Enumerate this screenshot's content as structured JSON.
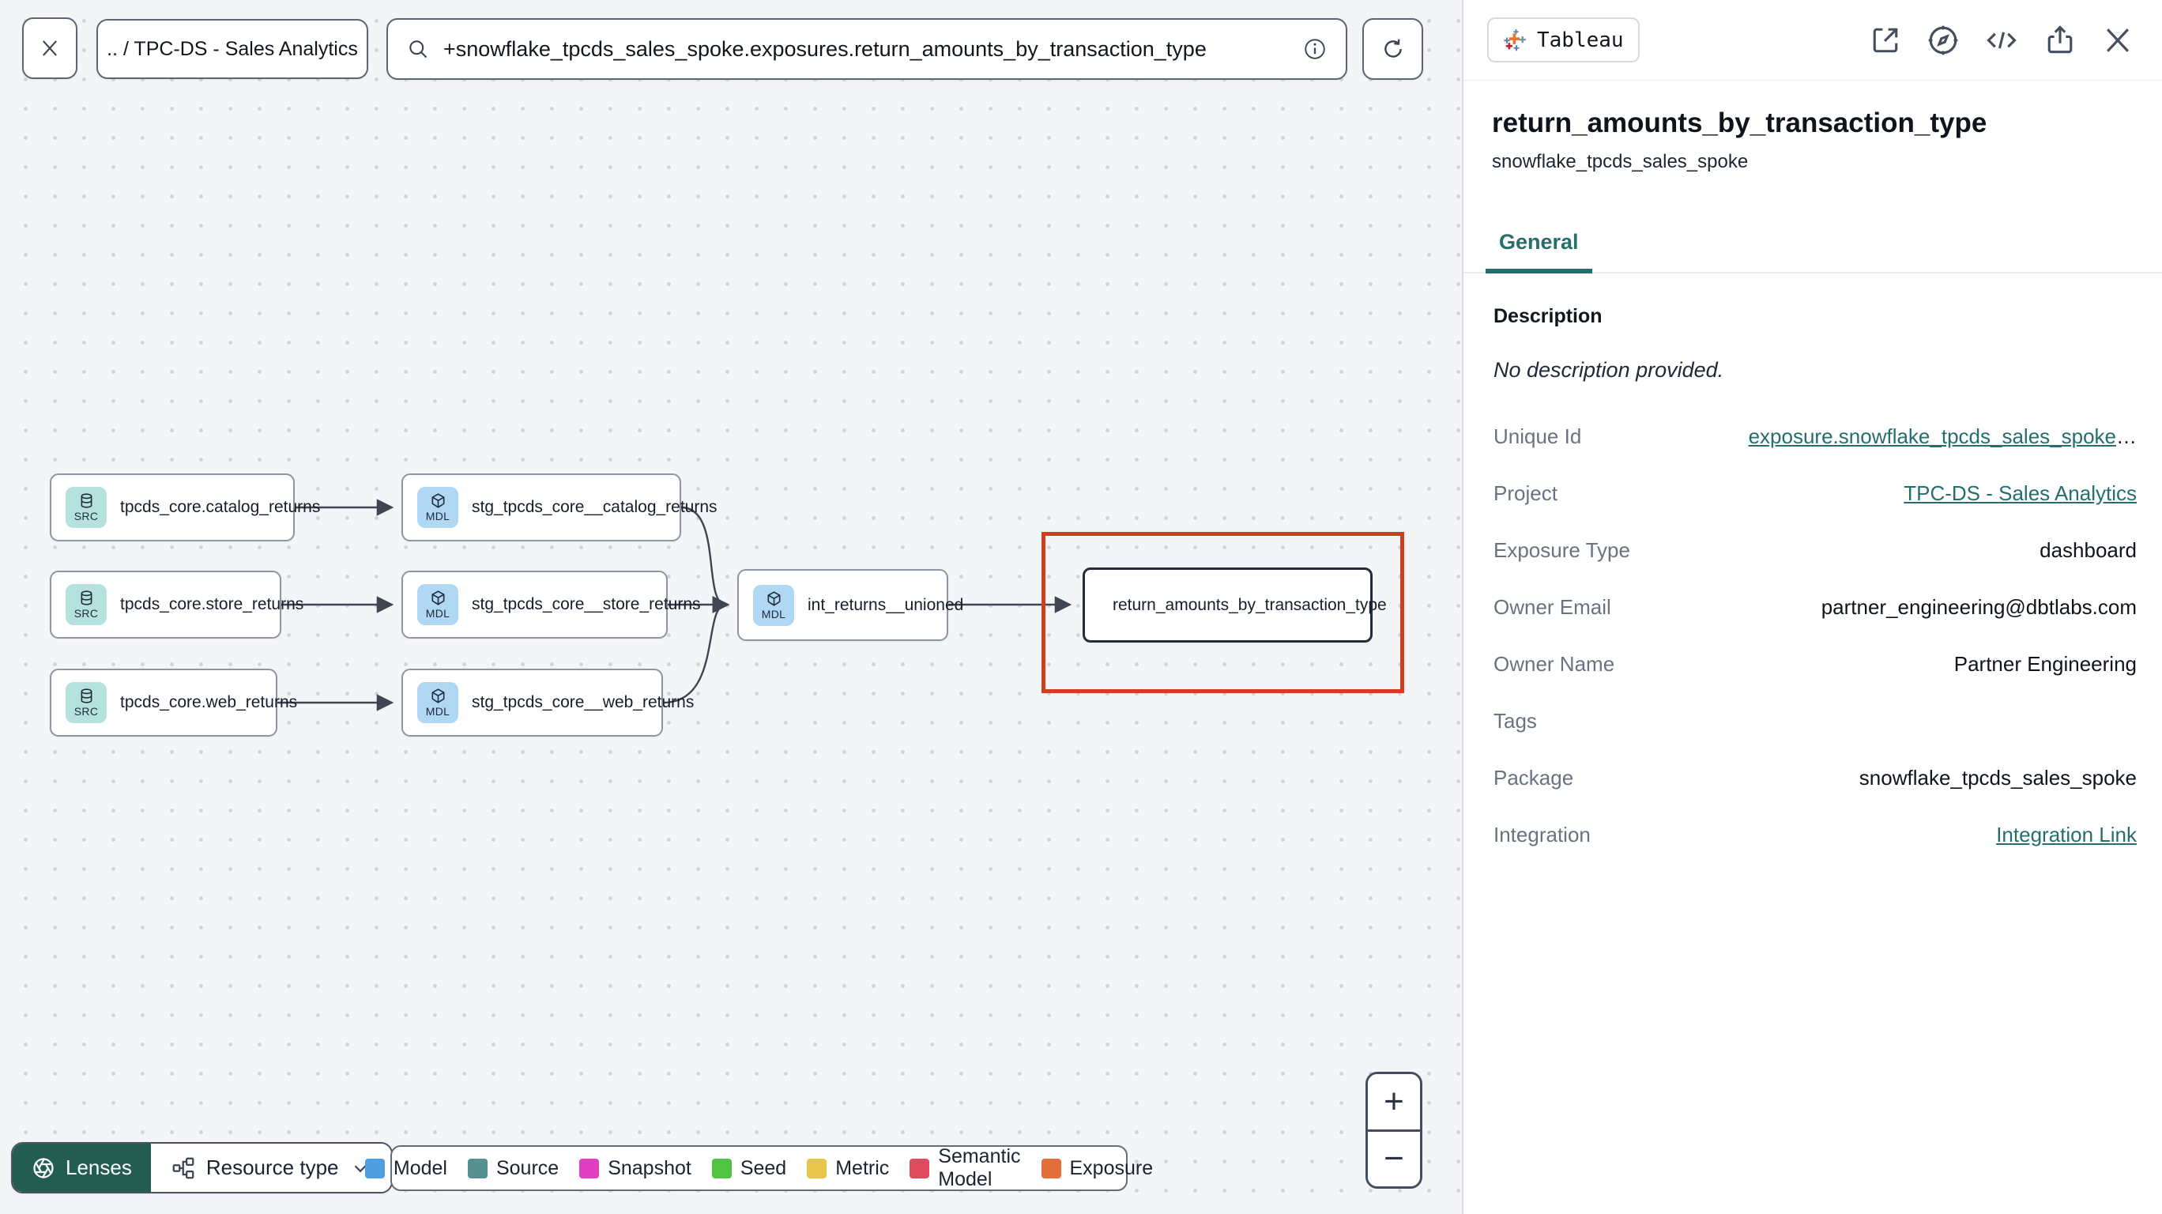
{
  "topbar": {
    "breadcrumb": ".. / TPC-DS - Sales Analytics",
    "search": {
      "value": "+snowflake_tpcds_sales_spoke.exposures.return_amounts_by_transaction_type"
    },
    "icons": [
      "close-icon",
      "search-icon",
      "info-icon",
      "refresh-icon"
    ]
  },
  "graph": {
    "badges": {
      "src": "SRC",
      "mdl": "MDL"
    },
    "nodes": [
      {
        "type": "source",
        "label": "tpcds_core.catalog_returns"
      },
      {
        "type": "model",
        "label": "stg_tpcds_core__catalog_returns"
      },
      {
        "type": "source",
        "label": "tpcds_core.store_returns"
      },
      {
        "type": "model",
        "label": "stg_tpcds_core__store_returns"
      },
      {
        "type": "source",
        "label": "tpcds_core.web_returns"
      },
      {
        "type": "model",
        "label": "stg_tpcds_core__web_returns"
      },
      {
        "type": "model",
        "label": "int_returns__unioned"
      },
      {
        "type": "exposure",
        "label": "return_amounts_by_transaction_type",
        "selected": true
      }
    ],
    "highlight_color": "#ce3f21"
  },
  "toolbar": {
    "lenses_label": "Lenses",
    "resource_type_label": "Resource type"
  },
  "legend": {
    "items": [
      {
        "label": "Model",
        "color": "#4e9fdf"
      },
      {
        "label": "Source",
        "color": "#569190"
      },
      {
        "label": "Snapshot",
        "color": "#e23cc0"
      },
      {
        "label": "Seed",
        "color": "#50c341"
      },
      {
        "label": "Metric",
        "color": "#e7c64a"
      },
      {
        "label": "Semantic Model",
        "color": "#e04a5f"
      },
      {
        "label": "Exposure",
        "color": "#e06f39"
      }
    ]
  },
  "zoom_controls": {
    "zoom_in": "+",
    "zoom_out": "−"
  },
  "panel": {
    "badge": "Tableau",
    "header_icons": [
      "open-in-new-icon",
      "compass-icon",
      "code-icon",
      "share-icon",
      "close-icon"
    ],
    "title": "return_amounts_by_transaction_type",
    "subtitle": "snowflake_tpcds_sales_spoke",
    "tab": "General",
    "description_label": "Description",
    "description_value": "No description provided.",
    "rows": [
      {
        "label": "Unique Id",
        "value": "exposure.snowflake_tpcds_sales_spoke",
        "ellipsis": "…",
        "link": true
      },
      {
        "label": "Project",
        "value": "TPC-DS - Sales Analytics",
        "link": true
      },
      {
        "label": "Exposure Type",
        "value": "dashboard"
      },
      {
        "label": "Owner Email",
        "value": "partner_engineering@dbtlabs.com"
      },
      {
        "label": "Owner Name",
        "value": "Partner Engineering"
      },
      {
        "label": "Tags",
        "value": ""
      },
      {
        "label": "Package",
        "value": "snowflake_tpcds_sales_spoke"
      },
      {
        "label": "Integration",
        "value": "Integration Link",
        "link": true
      }
    ],
    "accent_teal": "#266d6e"
  }
}
